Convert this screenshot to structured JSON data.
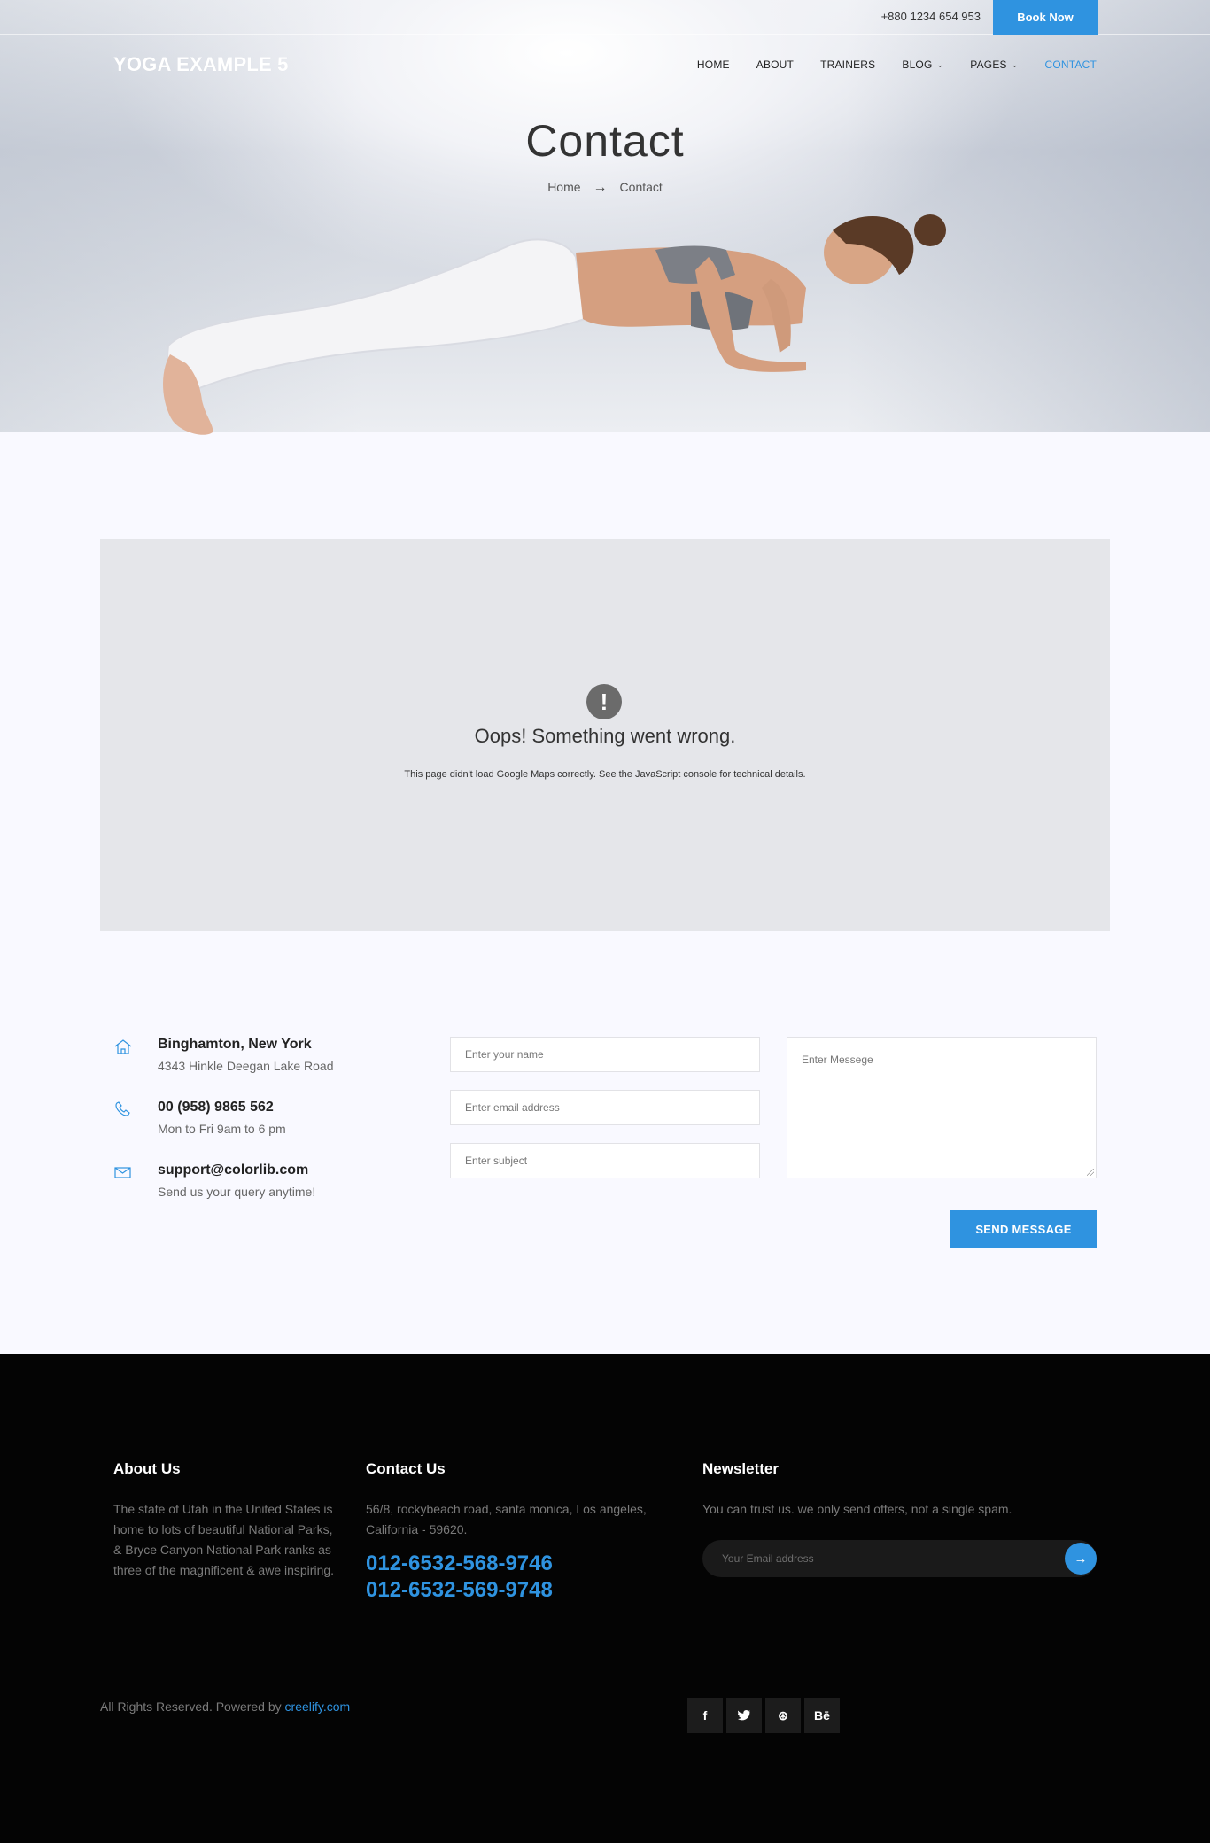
{
  "topbar": {
    "phone": "+880 1234 654 953",
    "book_label": "Book Now"
  },
  "brand": {
    "logo": "YOGA EXAMPLE 5"
  },
  "nav": {
    "items": [
      {
        "label": "HOME"
      },
      {
        "label": "ABOUT"
      },
      {
        "label": "TRAINERS"
      },
      {
        "label": "BLOG"
      },
      {
        "label": "PAGES"
      },
      {
        "label": "CONTACT"
      }
    ]
  },
  "hero": {
    "title": "Contact",
    "crumb_home": "Home",
    "crumb_current": "Contact"
  },
  "map": {
    "error_title": "Oops! Something went wrong.",
    "error_detail": "This page didn't load Google Maps correctly. See the JavaScript console for technical details."
  },
  "contact_info": [
    {
      "icon": "home-icon",
      "title": "Binghamton, New York",
      "sub": "4343 Hinkle Deegan Lake Road"
    },
    {
      "icon": "phone-icon",
      "title": "00 (958) 9865 562",
      "sub": "Mon to Fri 9am to 6 pm"
    },
    {
      "icon": "mail-icon",
      "title": "support@colorlib.com",
      "sub": "Send us your query anytime!"
    }
  ],
  "form": {
    "name_placeholder": "Enter your name",
    "email_placeholder": "Enter email address",
    "subject_placeholder": "Enter subject",
    "message_placeholder": "Enter Messege",
    "send_label": "SEND MESSAGE"
  },
  "footer": {
    "about_title": "About Us",
    "about_text": "The state of Utah in the United States is home to lots of beautiful National Parks, & Bryce Canyon National Park ranks as three of the magnificent & awe inspiring.",
    "contact_title": "Contact Us",
    "contact_address": "56/8, rockybeach road, santa monica, Los angeles, California - 59620.",
    "phone1": "012-6532-568-9746",
    "phone2": "012-6532-569-9748",
    "newsletter_title": "Newsletter",
    "newsletter_text": "You can trust us. we only send offers, not a single spam.",
    "newsletter_placeholder": "Your Email address",
    "copyright_prefix": "All Rights Reserved. Powered by ",
    "copyright_link": "creelify.com",
    "social": [
      {
        "icon": "facebook-icon",
        "glyph": "f"
      },
      {
        "icon": "twitter-icon",
        "glyph": "🐦"
      },
      {
        "icon": "dribbble-icon",
        "glyph": "⊛"
      },
      {
        "icon": "behance-icon",
        "glyph": "Bē"
      }
    ]
  },
  "colors": {
    "accent": "#2f93e0",
    "footer_bg": "#040404",
    "page_bg": "#f9f9ff"
  }
}
